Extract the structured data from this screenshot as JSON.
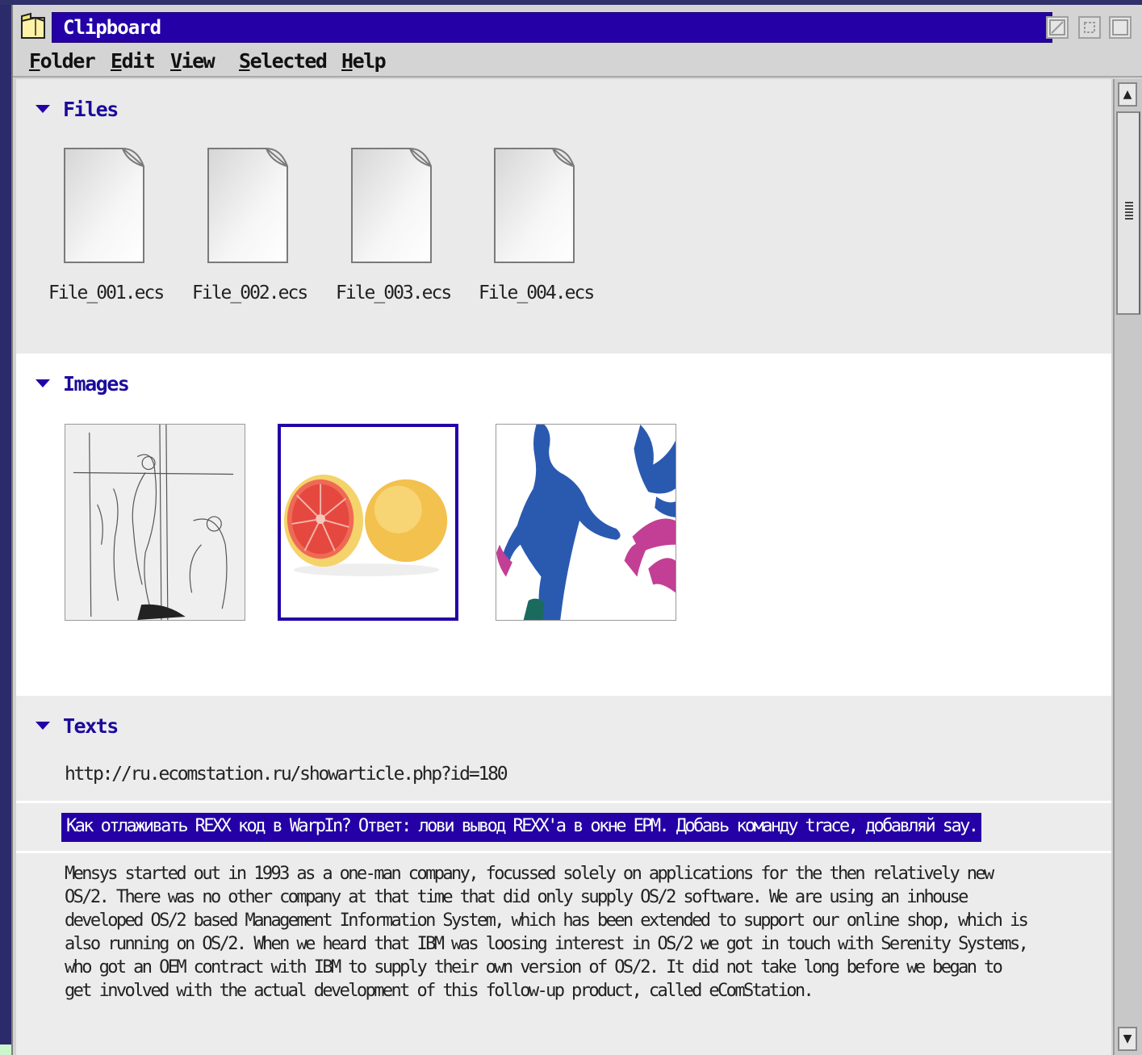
{
  "window": {
    "title": "Clipboard",
    "accent_color": "#2400a6"
  },
  "menu": {
    "items": [
      {
        "label": "Folder"
      },
      {
        "label": "Edit"
      },
      {
        "label": "View"
      },
      {
        "label": "Selected"
      },
      {
        "label": "Help"
      }
    ]
  },
  "files": {
    "title": "Files",
    "items": [
      {
        "label": "File_001.ecs"
      },
      {
        "label": "File_002.ecs"
      },
      {
        "label": "File_003.ecs"
      },
      {
        "label": "File_004.ecs"
      }
    ]
  },
  "images": {
    "title": "Images",
    "items": [
      {
        "name": "sketch-image"
      },
      {
        "name": "grapefruit-image",
        "selected": true
      },
      {
        "name": "figure-image"
      }
    ]
  },
  "texts": {
    "title": "Texts",
    "url": "http://ru.ecomstation.ru/showarticle.php?id=180",
    "selected_line": "Как отлаживать REXX код в WarpIn? Ответ: лови вывод REXX'а в окне EPM. Добавь команду trace, добавляй say.",
    "paragraph": "Mensys started out in 1993 as a one-man company, focussed solely on applications for the then relatively new OS/2. There was no other company at that time that did only supply OS/2 software. We are using an inhouse developed OS/2 based Management Information System, which has been extended to support our online shop, which is also running on OS/2. When we heard that IBM was loosing interest in OS/2 we got in touch with Serenity Systems, who got an OEM contract with IBM to supply their own version of OS/2. It did not take long before we began to get involved with the actual development of this follow-up product, called eComStation."
  }
}
